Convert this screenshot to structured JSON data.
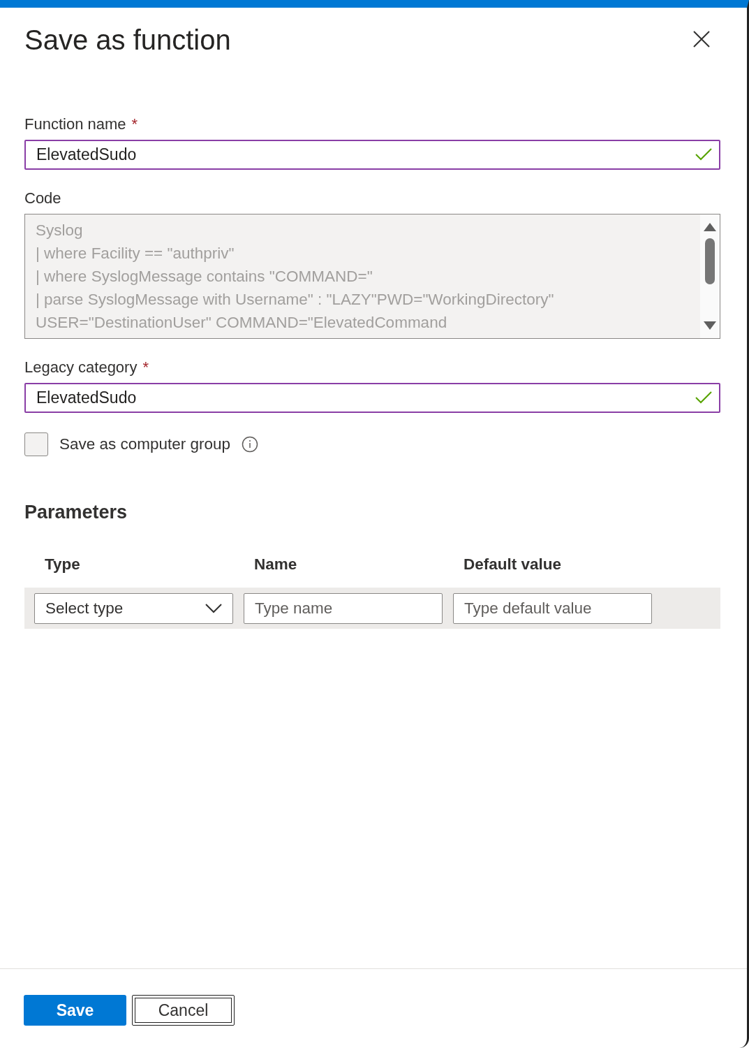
{
  "dialog": {
    "title": "Save as function"
  },
  "fields": [
    {
      "kind": "input",
      "label": "Function name",
      "required_mark": "*",
      "value": "ElevatedSudo",
      "valid": true
    },
    {
      "kind": "code",
      "label": "Code",
      "lines": [
        "Syslog",
        "| where Facility == \"authpriv\"",
        "| where SyslogMessage contains \"COMMAND=\"",
        "| parse SyslogMessage with Username\" : \"LAZY\"PWD=\"WorkingDirectory\"",
        "USER=\"DestinationUser\" COMMAND=\"ElevatedCommand"
      ]
    },
    {
      "kind": "input",
      "label": "Legacy category",
      "required_mark": "*",
      "value": "ElevatedSudo",
      "valid": true
    }
  ],
  "computer_group": {
    "label": "Save as computer group",
    "checked": false
  },
  "parameters": {
    "title": "Parameters",
    "columns": [
      "Type",
      "Name",
      "Default value"
    ],
    "row": [
      {
        "kind": "select",
        "placeholder": "Select type"
      },
      {
        "kind": "input",
        "placeholder": "Type name"
      },
      {
        "kind": "input",
        "placeholder": "Type default value"
      }
    ]
  },
  "buttons": [
    {
      "label": "Save",
      "primary": true
    },
    {
      "label": "Cancel",
      "primary": false
    }
  ]
}
